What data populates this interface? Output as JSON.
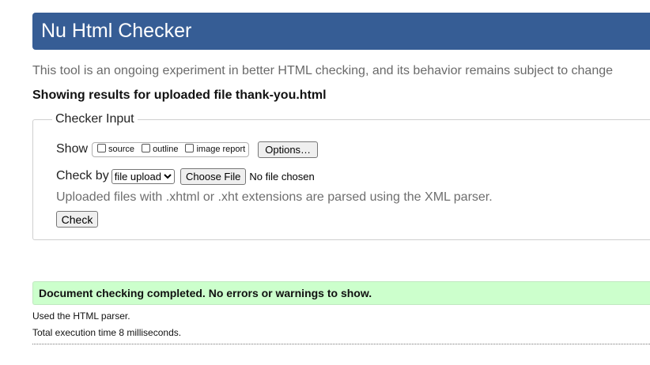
{
  "header": {
    "title": "Nu Html Checker",
    "background_color": "#365d95"
  },
  "tagline": "This tool is an ongoing experiment in better HTML checking, and its behavior remains subject to change",
  "results_heading": "Showing results for uploaded file thank-you.html",
  "checker_input": {
    "legend": "Checker Input",
    "show": {
      "label": "Show",
      "options": [
        {
          "label": "source",
          "checked": false
        },
        {
          "label": "outline",
          "checked": false
        },
        {
          "label": "image report",
          "checked": false
        }
      ],
      "options_button": "Options…"
    },
    "check_by": {
      "label": "Check by",
      "selected": "file upload",
      "choose_file_button": "Choose File",
      "file_status": "No file chosen"
    },
    "hint": "Uploaded files with .xhtml or .xht extensions are parsed using the XML parser.",
    "check_button": "Check"
  },
  "result": {
    "message": "Document checking completed. No errors or warnings to show.",
    "background_color": "#ccffcc"
  },
  "parser_note": "Used the HTML parser.",
  "execution_time": "Total execution time 8 milliseconds."
}
